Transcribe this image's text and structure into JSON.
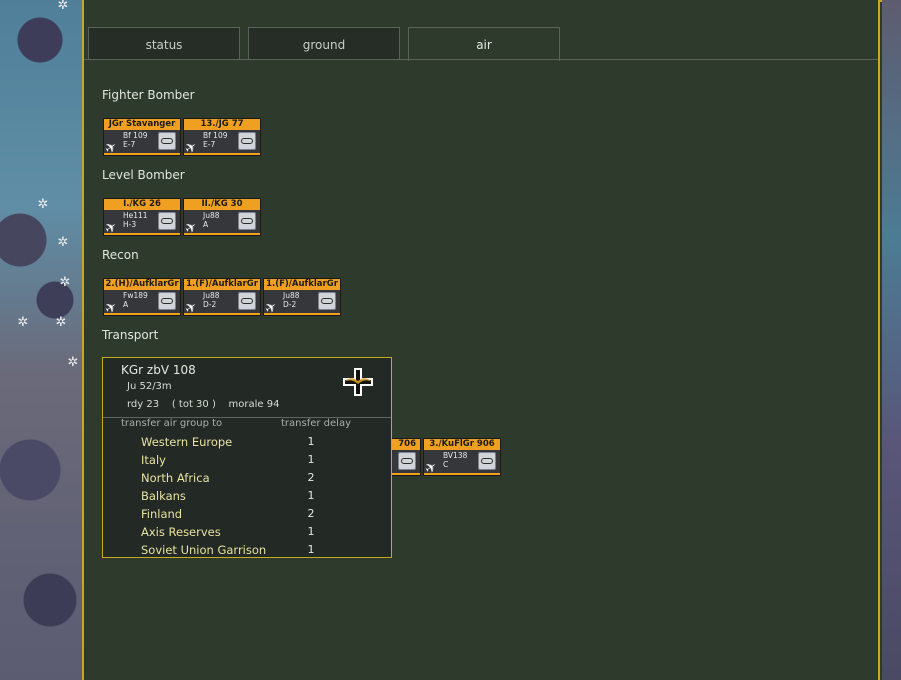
{
  "tabs": [
    {
      "label": "status",
      "active": false
    },
    {
      "label": "ground",
      "active": false
    },
    {
      "label": "air",
      "active": true
    }
  ],
  "sections": {
    "fighter_bomber": "Fighter Bomber",
    "level_bomber": "Level Bomber",
    "recon": "Recon",
    "transport": "Transport"
  },
  "units": {
    "fighter_bomber": [
      {
        "name": "JGr Stavanger",
        "type": "Bf 109",
        "variant": "E-7"
      },
      {
        "name": "13./JG 77",
        "type": "Bf 109",
        "variant": "E-7"
      }
    ],
    "level_bomber": [
      {
        "name": "I./KG 26",
        "type": "He111",
        "variant": "H-3"
      },
      {
        "name": "II./KG 30",
        "type": "Ju88",
        "variant": "A"
      }
    ],
    "recon": [
      {
        "name": "2.(H)/AufklarGr",
        "type": "Fw189",
        "variant": "A"
      },
      {
        "name": "1.(F)/AufklarGr",
        "type": "Ju88",
        "variant": "D-2"
      },
      {
        "name": "1.(F)/AufklarGr",
        "type": "Ju88",
        "variant": "D-2"
      }
    ],
    "transport_partial": [
      {
        "name": "706",
        "type": "",
        "variant": ""
      },
      {
        "name": "3./KuFlGr 906",
        "type": "BV138",
        "variant": "C"
      }
    ]
  },
  "popup": {
    "title": "KGr zbV 108",
    "subtype": "Ju 52/3m",
    "stats": "rdy 23    ( tot 30 )    morale 94",
    "header_dest": "transfer air group to",
    "header_delay": "transfer delay",
    "destinations": [
      {
        "name": "Western Europe",
        "delay": "1"
      },
      {
        "name": "Italy",
        "delay": "1"
      },
      {
        "name": "North Africa",
        "delay": "2"
      },
      {
        "name": "Balkans",
        "delay": "1"
      },
      {
        "name": "Finland",
        "delay": "2"
      },
      {
        "name": "Axis Reserves",
        "delay": "1"
      },
      {
        "name": "Soviet Union Garrison",
        "delay": "1"
      }
    ]
  },
  "colors": {
    "accent": "#c8a823",
    "counter_header": "#f0a020",
    "panel_bg": "#2e3a2c",
    "destination_text": "#e8e2a0"
  }
}
